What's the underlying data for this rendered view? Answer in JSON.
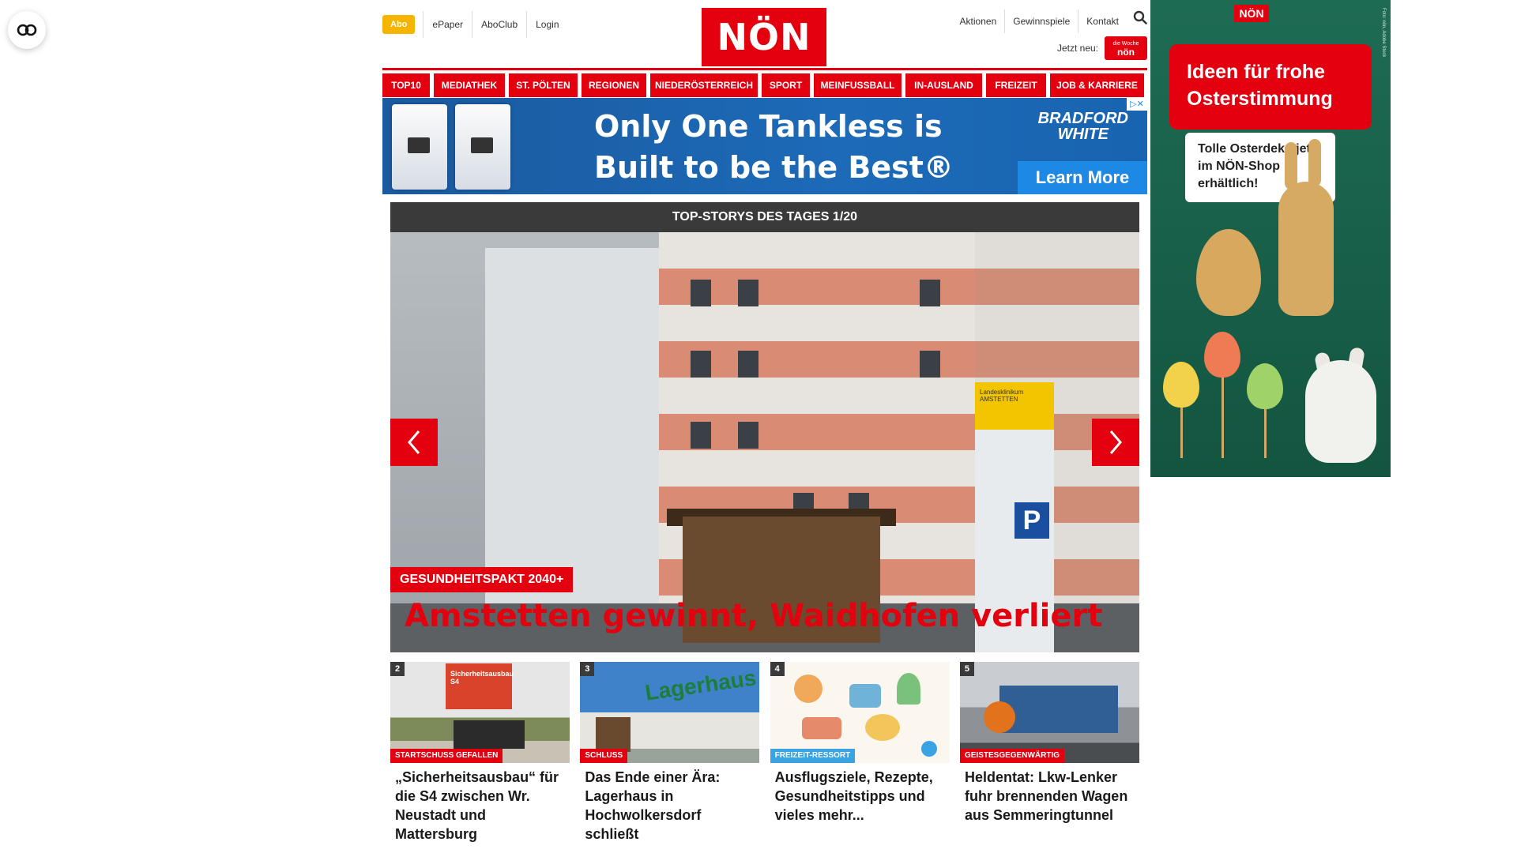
{
  "utility": {
    "abo": "Abo",
    "left_links": [
      "ePaper",
      "AboClub",
      "Login"
    ],
    "right_links": [
      "Aktionen",
      "Gewinnspiele",
      "Kontakt"
    ],
    "jetzt_neu": "Jetzt neu:",
    "app_badge_small": "die Woche",
    "app_badge": "nön"
  },
  "logo": "NÖN",
  "nav": [
    "TOP10",
    "MEDIATHEK",
    "ST. PÖLTEN",
    "REGIONEN",
    "NIEDERÖSTERREICH",
    "SPORT",
    "MEINFUSSBALL",
    "IN-AUSLAND",
    "FREIZEIT",
    "JOB & KARRIERE"
  ],
  "ad_banner": {
    "line1": "Only One Tankless is",
    "line2": "Built to be the Best®",
    "brand1": "BRADFORD",
    "brand2": "WHITE",
    "cta": "Learn More",
    "close": "▷✕"
  },
  "hero": {
    "header": "TOP-STORYS DES TAGES 1/20",
    "tag": "GESUNDHEITSPAKT 2040+",
    "title": "Amstetten gewinnt, Waidhofen verliert",
    "sign_top": "Landesklinikum AMSTETTEN",
    "sign_p": "P"
  },
  "teasers": [
    {
      "num": "2",
      "category": "STARTSCHUSS GEFALLEN",
      "title": "„Sicherheitsausbau“ für die S4 zwischen Wr. Neustadt und Mattersburg",
      "thumb_text": "Sicherheitsausbau S4"
    },
    {
      "num": "3",
      "category": "SCHLUSS",
      "title": "Das Ende einer Ära: Lagerhaus in Hochwolkersdorf schließt",
      "thumb_text": "Lagerhaus"
    },
    {
      "num": "4",
      "category": "FREIZEIT-RESSORT",
      "title": "Ausflugsziele, Rezepte, Gesundheitstipps und vieles mehr...",
      "thumb_text": ""
    },
    {
      "num": "5",
      "category": "GEISTESGEGENWÄRTIG",
      "title": "Heldentat: Lkw-Lenker fuhr brennenden Wagen aus Semmeringtunnel",
      "thumb_text": ""
    }
  ],
  "right_ad": {
    "logo": "NÖN",
    "headline": "Ideen für frohe Osterstimmung",
    "note": "Tolle Osterdeko jetzt im NÖN-Shop erhältlich!",
    "side": "Foto: nön, Adobe Stock"
  },
  "colors": {
    "brand_red": "#e3000f",
    "abo_yellow": "#f5b400",
    "dark_bar": "#3a3a3a",
    "ad_green": "#1e6b53"
  }
}
